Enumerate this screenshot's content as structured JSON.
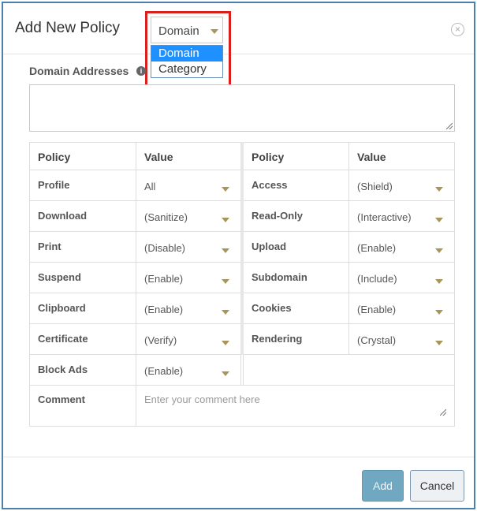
{
  "dialog": {
    "title": "Add New Policy",
    "close_label": "×"
  },
  "type_select": {
    "value": "Domain",
    "options": [
      "Domain",
      "Category"
    ],
    "selected_index": 0
  },
  "domain": {
    "label": "Domain Addresses",
    "info_icon": "i",
    "value": ""
  },
  "table": {
    "headers": [
      "Policy",
      "Value",
      "Policy",
      "Value"
    ],
    "left_rows": [
      {
        "policy": "Profile",
        "value": "All"
      },
      {
        "policy": "Download",
        "value": "(Sanitize)"
      },
      {
        "policy": "Print",
        "value": "(Disable)"
      },
      {
        "policy": "Suspend",
        "value": "(Enable)"
      },
      {
        "policy": "Clipboard",
        "value": "(Enable)"
      },
      {
        "policy": "Certificate",
        "value": "(Verify)"
      },
      {
        "policy": "Block Ads",
        "value": "(Enable)"
      }
    ],
    "right_rows": [
      {
        "policy": "Access",
        "value": "(Shield)"
      },
      {
        "policy": "Read-Only",
        "value": "(Interactive)"
      },
      {
        "policy": "Upload",
        "value": "(Enable)"
      },
      {
        "policy": "Subdomain",
        "value": "(Include)"
      },
      {
        "policy": "Cookies",
        "value": "(Enable)"
      },
      {
        "policy": "Rendering",
        "value": "(Crystal)"
      }
    ]
  },
  "comment": {
    "label": "Comment",
    "placeholder": "Enter your comment here"
  },
  "buttons": {
    "add": "Add",
    "cancel": "Cancel"
  },
  "colors": {
    "accent_border": "#4a7fae",
    "highlight_red": "#d9201c",
    "dropdown_selected": "#1e90ff",
    "caret": "#a8955a",
    "add_button": "#6fa8c0"
  }
}
